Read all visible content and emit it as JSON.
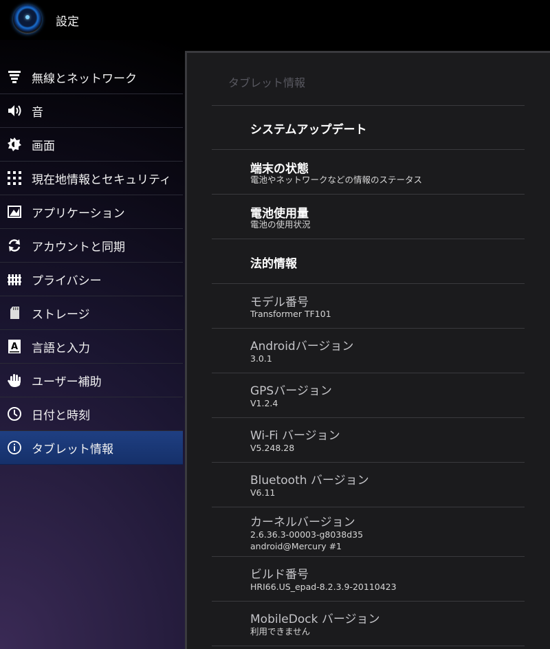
{
  "app": {
    "title": "設定"
  },
  "sidebar": {
    "items": [
      {
        "label": "無線とネットワーク",
        "icon": "wifi-signal-icon",
        "selected": false
      },
      {
        "label": "音",
        "icon": "speaker-icon",
        "selected": false
      },
      {
        "label": "画面",
        "icon": "brightness-icon",
        "selected": false
      },
      {
        "label": "現在地情報とセキュリティ",
        "icon": "pattern-lock-icon",
        "selected": false
      },
      {
        "label": "アプリケーション",
        "icon": "applications-icon",
        "selected": false
      },
      {
        "label": "アカウントと同期",
        "icon": "sync-icon",
        "selected": false
      },
      {
        "label": "プライバシー",
        "icon": "privacy-fence-icon",
        "selected": false
      },
      {
        "label": "ストレージ",
        "icon": "sd-card-icon",
        "selected": false
      },
      {
        "label": "言語と入力",
        "icon": "language-keyboard-icon",
        "selected": false
      },
      {
        "label": "ユーザー補助",
        "icon": "hand-icon",
        "selected": false
      },
      {
        "label": "日付と時刻",
        "icon": "clock-icon",
        "selected": false
      },
      {
        "label": "タブレット情報",
        "icon": "info-icon",
        "selected": true
      }
    ]
  },
  "panel": {
    "header": "タブレット情報",
    "rows": [
      {
        "title": "システムアップデート",
        "subtitle": "",
        "style": "bold"
      },
      {
        "title": "端末の状態",
        "subtitle": "電池やネットワークなどの情報のステータス",
        "style": "bold"
      },
      {
        "title": "電池使用量",
        "subtitle": "電池の使用状況",
        "style": "bold"
      },
      {
        "title": "法的情報",
        "subtitle": "",
        "style": "bold"
      },
      {
        "title": "モデル番号",
        "subtitle": "Transformer TF101",
        "style": "dim"
      },
      {
        "title": "Androidバージョン",
        "subtitle": "3.0.1",
        "style": "dim"
      },
      {
        "title": "GPSバージョン",
        "subtitle": "V1.2.4",
        "style": "dim"
      },
      {
        "title": "Wi-Fi バージョン",
        "subtitle": "V5.248.28",
        "style": "dim"
      },
      {
        "title": "Bluetooth バージョン",
        "subtitle": "V6.11",
        "style": "dim"
      },
      {
        "title": "カーネルバージョン",
        "subtitle": "2.6.36.3-00003-g8038d35",
        "subtitle2": "android@Mercury #1",
        "style": "dim"
      },
      {
        "title": "ビルド番号",
        "subtitle": "HRI66.US_epad-8.2.3.9-20110423",
        "style": "dim"
      },
      {
        "title": "MobileDock バージョン",
        "subtitle": "利用できません",
        "style": "dim"
      }
    ]
  }
}
